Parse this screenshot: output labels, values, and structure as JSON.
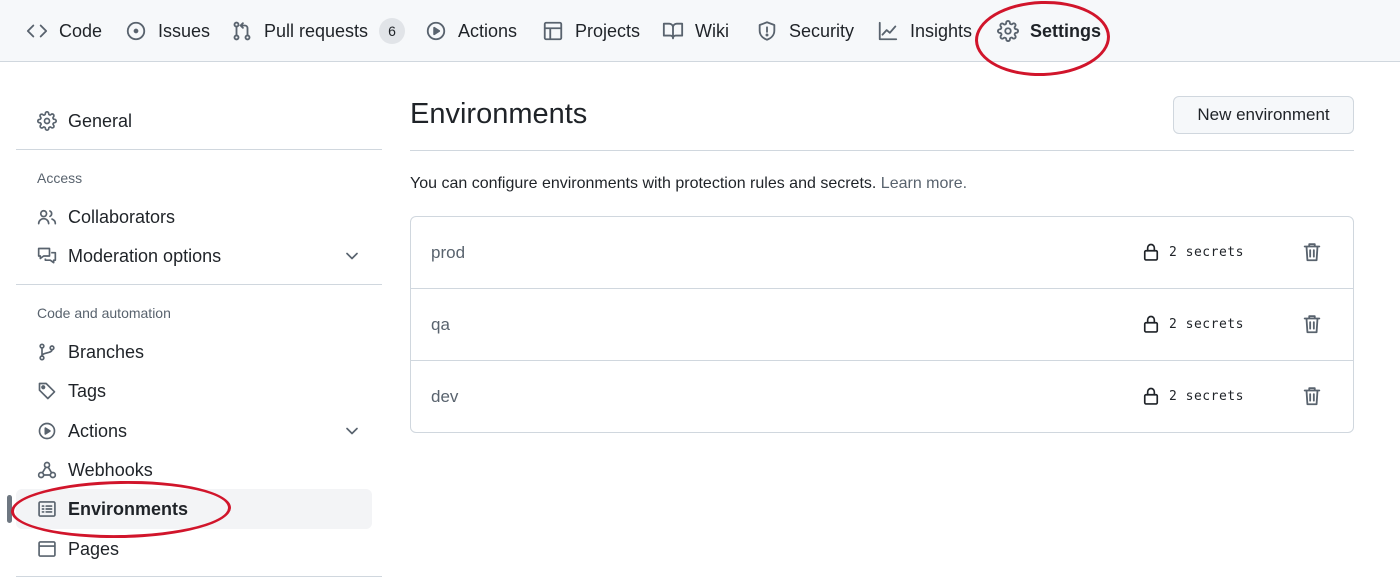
{
  "repo_nav": {
    "tabs": [
      {
        "label": "Code",
        "icon": "code-icon"
      },
      {
        "label": "Issues",
        "icon": "issue-opened-icon"
      },
      {
        "label": "Pull requests",
        "icon": "git-pull-request-icon",
        "count": "6"
      },
      {
        "label": "Actions",
        "icon": "play-icon"
      },
      {
        "label": "Projects",
        "icon": "table-icon"
      },
      {
        "label": "Wiki",
        "icon": "book-icon"
      },
      {
        "label": "Security",
        "icon": "shield-icon"
      },
      {
        "label": "Insights",
        "icon": "graph-icon"
      },
      {
        "label": "Settings",
        "icon": "gear-icon",
        "active": true
      }
    ]
  },
  "sidebar": {
    "general": {
      "label": "General",
      "icon": "gear-icon"
    },
    "access_heading": "Access",
    "access_items": [
      {
        "label": "Collaborators",
        "icon": "people-icon"
      },
      {
        "label": "Moderation options",
        "icon": "comment-discussion-icon",
        "expandable": true
      }
    ],
    "code_heading": "Code and automation",
    "code_items": [
      {
        "label": "Branches",
        "icon": "git-branch-icon"
      },
      {
        "label": "Tags",
        "icon": "tag-icon"
      },
      {
        "label": "Actions",
        "icon": "play-icon",
        "expandable": true
      },
      {
        "label": "Webhooks",
        "icon": "webhook-icon"
      },
      {
        "label": "Environments",
        "icon": "server-icon",
        "active": true
      },
      {
        "label": "Pages",
        "icon": "browser-icon"
      }
    ]
  },
  "main": {
    "title": "Environments",
    "new_button": "New environment",
    "description": "You can configure environments with protection rules and secrets.",
    "learn_more": "Learn more.",
    "environments": [
      {
        "name": "prod",
        "secrets": "2 secrets"
      },
      {
        "name": "qa",
        "secrets": "2 secrets"
      },
      {
        "name": "dev",
        "secrets": "2 secrets"
      }
    ]
  },
  "colors": {
    "highlight_circle": "#d1152b",
    "border": "#d0d7de",
    "muted_text": "#59636e"
  }
}
